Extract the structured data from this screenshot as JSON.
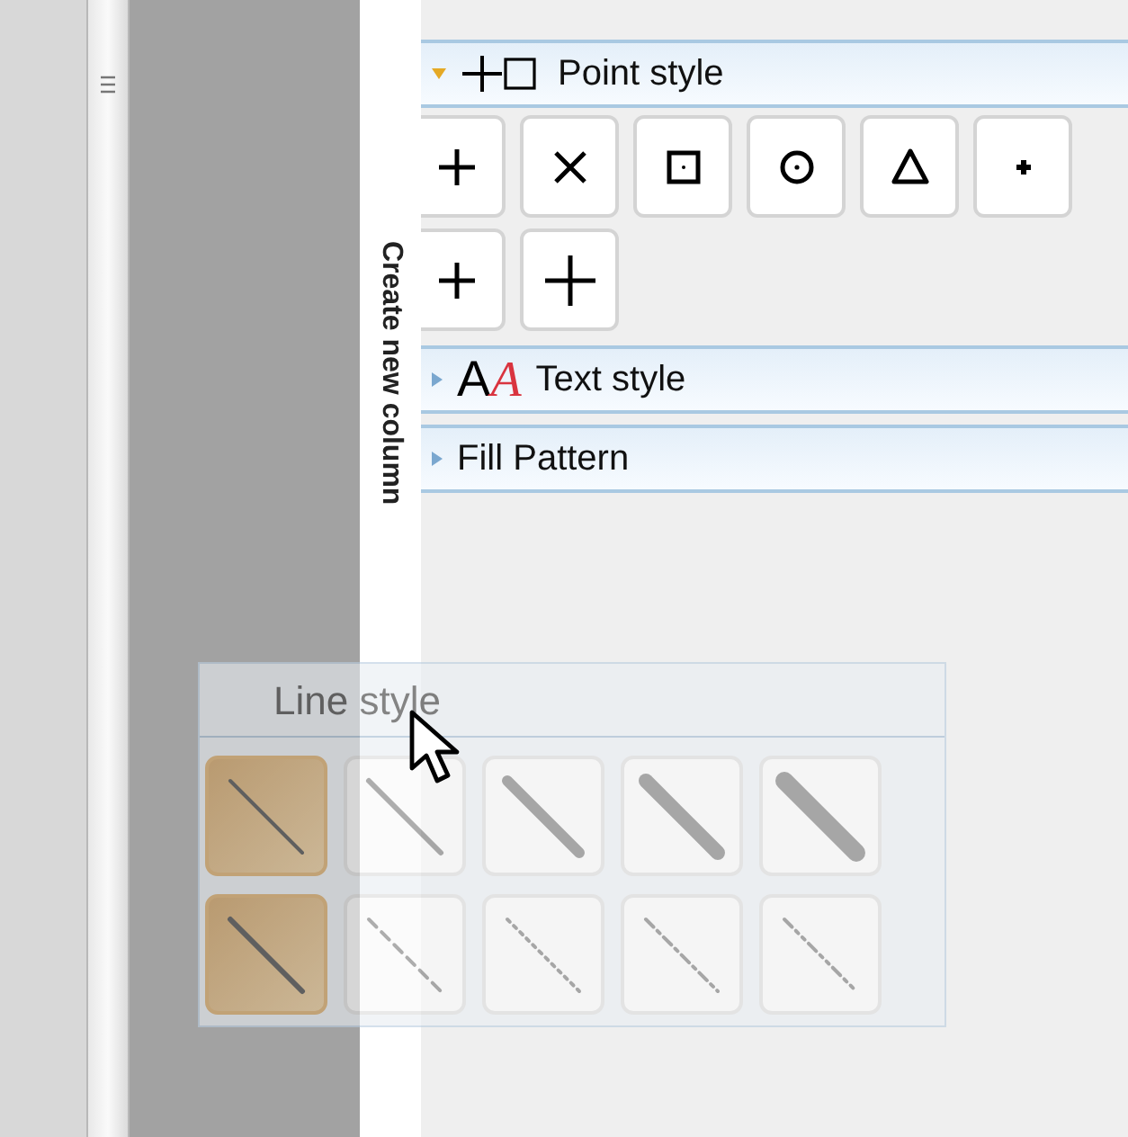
{
  "side_label": "Create new column",
  "sections": [
    {
      "title": "Point style",
      "expanded": true,
      "kind": "point",
      "markers": [
        {
          "kind": "plus"
        },
        {
          "kind": "cross"
        },
        {
          "kind": "square"
        },
        {
          "kind": "circle"
        },
        {
          "kind": "triangle"
        },
        {
          "kind": "dot"
        },
        {
          "kind": "plus"
        },
        {
          "kind": "big-plus"
        }
      ]
    },
    {
      "title": "Text style",
      "expanded": false,
      "kind": "text",
      "icon_glyphs": [
        "A",
        "A"
      ]
    },
    {
      "title": "Fill Pattern",
      "expanded": false,
      "kind": "plain"
    }
  ],
  "dragged_panel": {
    "title": "Line style",
    "lines": [
      {
        "kind": "solid-1",
        "selected": true
      },
      {
        "kind": "solid-2",
        "selected": false
      },
      {
        "kind": "solid-3",
        "selected": false
      },
      {
        "kind": "solid-4",
        "selected": false
      },
      {
        "kind": "solid-5",
        "selected": false
      },
      {
        "kind": "solid-2",
        "selected": true
      },
      {
        "kind": "dashed",
        "selected": false
      },
      {
        "kind": "dotted",
        "selected": false
      },
      {
        "kind": "dash-dot",
        "selected": false
      },
      {
        "kind": "dash-dot-dot",
        "selected": false
      }
    ]
  }
}
